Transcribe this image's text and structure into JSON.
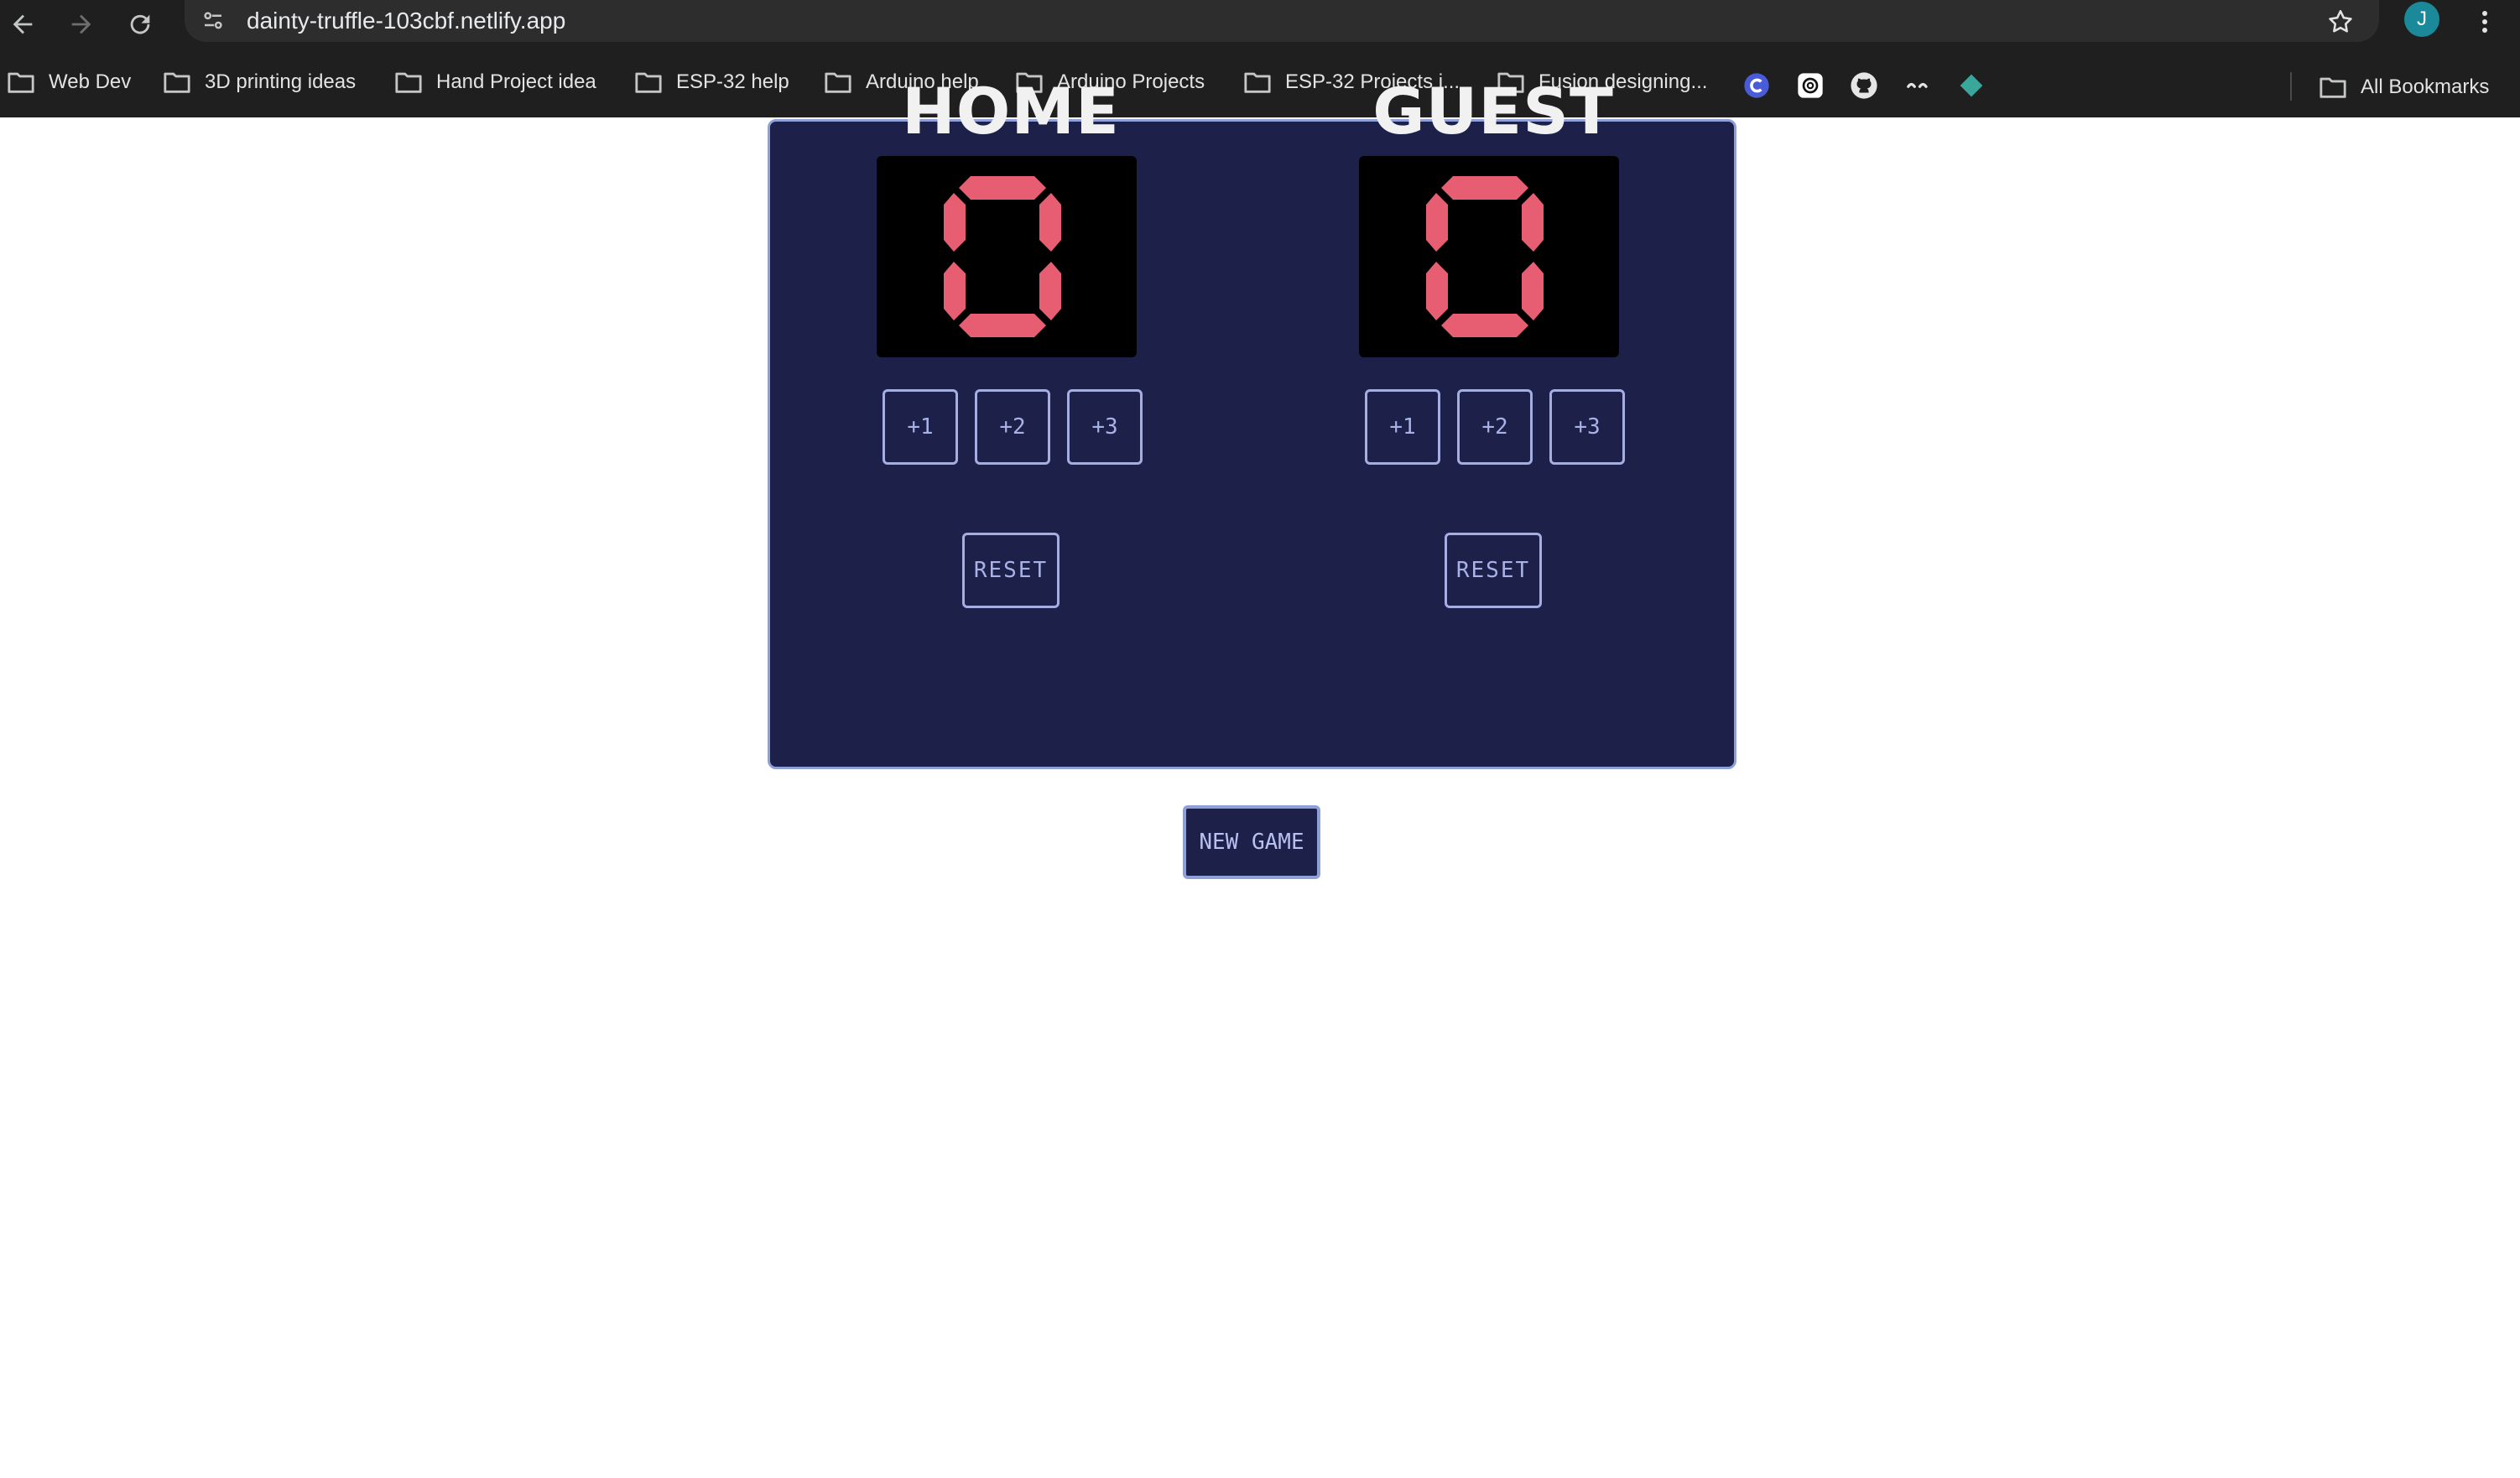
{
  "browser": {
    "url": "dainty-truffle-103cbf.netlify.app",
    "avatar_initial": "J",
    "icons": [
      "back-icon",
      "forward-icon",
      "reload-icon",
      "site-info-icon",
      "star-icon",
      "kebab-menu-icon"
    ]
  },
  "bookmarks": {
    "items": [
      {
        "label": "Web Dev"
      },
      {
        "label": "3D printing ideas"
      },
      {
        "label": "Hand Project idea"
      },
      {
        "label": "ESP-32 help"
      },
      {
        "label": "Arduino help"
      },
      {
        "label": "Arduino Projects"
      },
      {
        "label": "ESP-32 Projects i..."
      },
      {
        "label": "Fusion designing..."
      }
    ],
    "app_icons": [
      "c-logo-icon",
      "openai-icon",
      "github-icon",
      "dash-icon",
      "diamond-icon"
    ],
    "all_bookmarks": "All Bookmarks"
  },
  "scoreboard": {
    "home": {
      "title": "HOME",
      "score": "0",
      "buttons": [
        "+1",
        "+2",
        "+3"
      ],
      "reset": "RESET"
    },
    "guest": {
      "title": "GUEST",
      "score": "0",
      "buttons": [
        "+1",
        "+2",
        "+3"
      ],
      "reset": "RESET"
    },
    "new_game": "NEW GAME"
  },
  "colors": {
    "board_bg": "#1d214a",
    "board_border": "#8f9fd8",
    "digit": "#e75e72",
    "button_text": "#a8b2e6"
  }
}
